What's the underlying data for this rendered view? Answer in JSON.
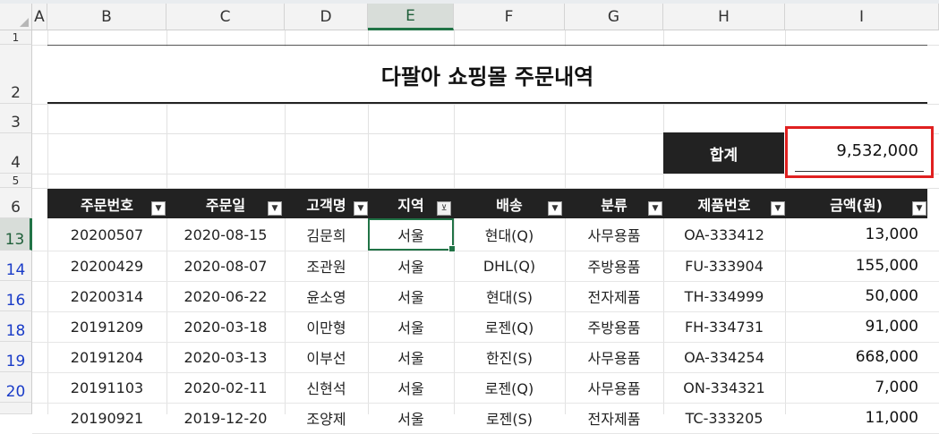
{
  "columns": [
    "A",
    "B",
    "C",
    "D",
    "E",
    "F",
    "G",
    "H",
    "I"
  ],
  "selected_column": "E",
  "row_numbers": {
    "r1": "1",
    "r2": "2",
    "r3": "3",
    "r4": "4",
    "r5": "5",
    "r6": "6",
    "data": [
      "13",
      "14",
      "16",
      "18",
      "19",
      "20"
    ]
  },
  "sheet": {
    "title": "다팔아 쇼핑몰 주문내역",
    "total_label": "합계",
    "total_value": "9,532,000"
  },
  "table": {
    "headers": [
      "주문번호",
      "주문일",
      "고객명",
      "지역",
      "배송",
      "분류",
      "제품번호",
      "금액(원)"
    ],
    "filter_active_column": "지역",
    "rows": [
      [
        "20200507",
        "2020-08-15",
        "김문희",
        "서울",
        "현대(Q)",
        "사무용품",
        "OA-333412",
        "13,000"
      ],
      [
        "20200429",
        "2020-08-07",
        "조관원",
        "서울",
        "DHL(Q)",
        "주방용품",
        "FU-333904",
        "155,000"
      ],
      [
        "20200314",
        "2020-06-22",
        "윤소영",
        "서울",
        "현대(S)",
        "전자제품",
        "TH-334999",
        "50,000"
      ],
      [
        "20191209",
        "2020-03-18",
        "이만형",
        "서울",
        "로젠(Q)",
        "주방용품",
        "FH-334731",
        "91,000"
      ],
      [
        "20191204",
        "2020-03-13",
        "이부선",
        "서울",
        "한진(S)",
        "사무용품",
        "OA-334254",
        "668,000"
      ],
      [
        "20191103",
        "2020-02-11",
        "신현석",
        "서울",
        "로젠(Q)",
        "사무용품",
        "ON-334321",
        "7,000"
      ],
      [
        "20190921",
        "2019-12-20",
        "조양제",
        "서울",
        "로젠(S)",
        "전자제품",
        "TC-333205",
        "11,000"
      ]
    ]
  },
  "colors": {
    "header_bg": "#222222",
    "selection": "#217346",
    "highlight_border": "#e02020",
    "filtered_row_num": "#1a3cc8"
  }
}
